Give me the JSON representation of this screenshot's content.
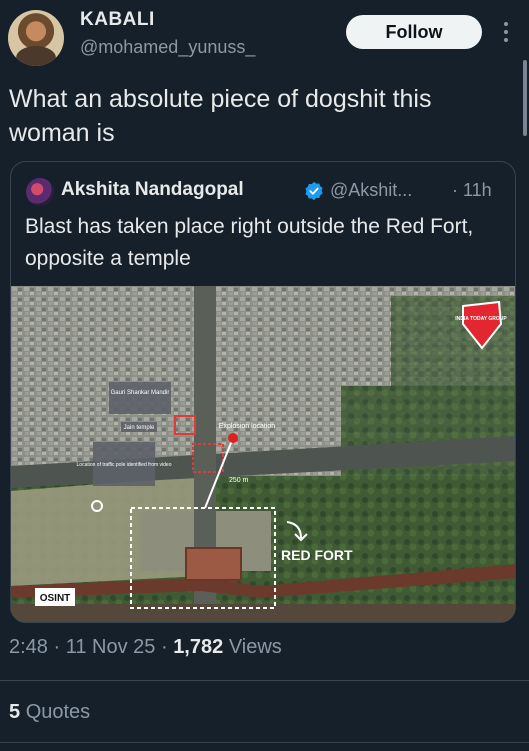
{
  "author": {
    "display_name": "KABALI",
    "handle": "@mohamed_yunuss_"
  },
  "follow_label": "Follow",
  "tweet_text": "What an absolute piece of dogshit this woman is",
  "quoted": {
    "display_name": "Akshita Nandagopal",
    "handle": "@Akshit...",
    "time": "· 11h",
    "text": "Blast has taken place right outside the Red Fort, opposite a temple",
    "image": {
      "labels": {
        "temple": "Gauri Shankar Mandir",
        "jain_temple": "Jain temple",
        "traffic_pole": "Location of traffic pole identified from video",
        "explosion": "Explosion location",
        "distance": "250 m",
        "fort": "RED FORT",
        "watermark": "OSINT",
        "logo": "INDIA TODAY GROUP"
      }
    }
  },
  "meta": {
    "time": "2:48",
    "date": "11 Nov 25",
    "views_count": "1,782",
    "views_label": "Views"
  },
  "quotes": {
    "count": "5",
    "label": "Quotes"
  },
  "colors": {
    "background": "#15202b",
    "text": "#e7e9ea",
    "secondary": "#8b98a5",
    "verified": "#1d9bf0",
    "border": "#38444d"
  }
}
